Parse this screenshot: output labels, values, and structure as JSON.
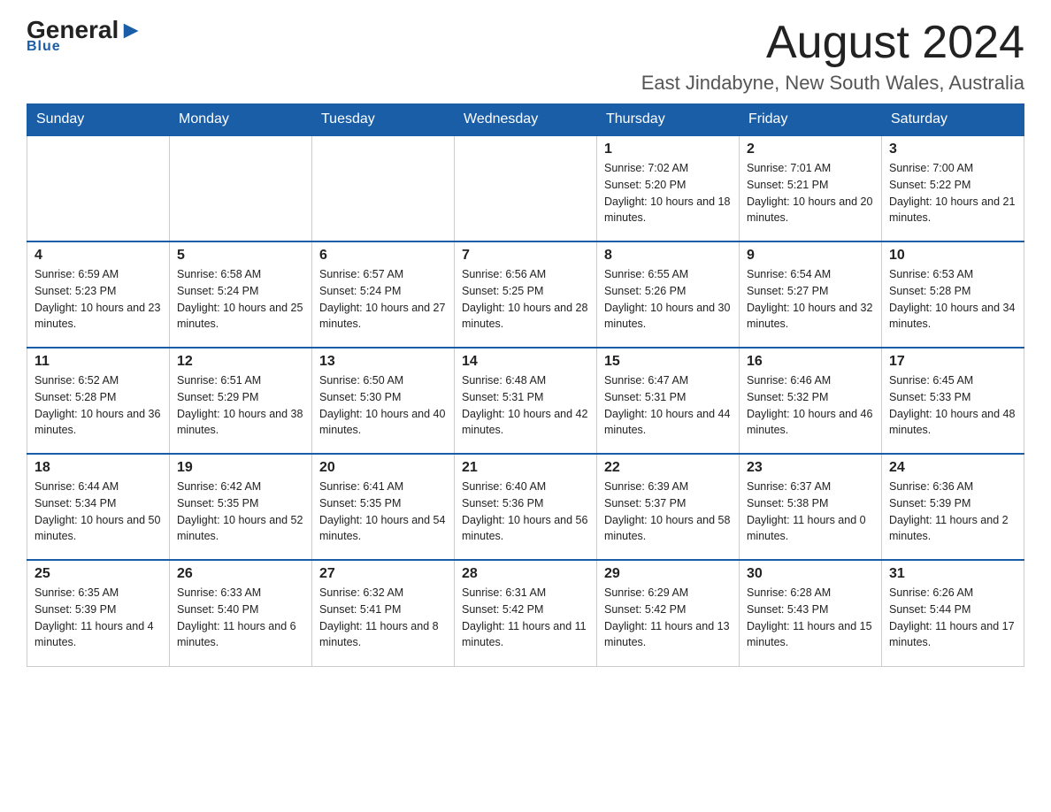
{
  "header": {
    "logo_general": "General",
    "logo_blue": "Blue",
    "month_title": "August 2024",
    "location": "East Jindabyne, New South Wales, Australia"
  },
  "days_of_week": [
    "Sunday",
    "Monday",
    "Tuesday",
    "Wednesday",
    "Thursday",
    "Friday",
    "Saturday"
  ],
  "weeks": [
    [
      {
        "num": "",
        "sunrise": "",
        "sunset": "",
        "daylight": ""
      },
      {
        "num": "",
        "sunrise": "",
        "sunset": "",
        "daylight": ""
      },
      {
        "num": "",
        "sunrise": "",
        "sunset": "",
        "daylight": ""
      },
      {
        "num": "",
        "sunrise": "",
        "sunset": "",
        "daylight": ""
      },
      {
        "num": "1",
        "sunrise": "Sunrise: 7:02 AM",
        "sunset": "Sunset: 5:20 PM",
        "daylight": "Daylight: 10 hours and 18 minutes."
      },
      {
        "num": "2",
        "sunrise": "Sunrise: 7:01 AM",
        "sunset": "Sunset: 5:21 PM",
        "daylight": "Daylight: 10 hours and 20 minutes."
      },
      {
        "num": "3",
        "sunrise": "Sunrise: 7:00 AM",
        "sunset": "Sunset: 5:22 PM",
        "daylight": "Daylight: 10 hours and 21 minutes."
      }
    ],
    [
      {
        "num": "4",
        "sunrise": "Sunrise: 6:59 AM",
        "sunset": "Sunset: 5:23 PM",
        "daylight": "Daylight: 10 hours and 23 minutes."
      },
      {
        "num": "5",
        "sunrise": "Sunrise: 6:58 AM",
        "sunset": "Sunset: 5:24 PM",
        "daylight": "Daylight: 10 hours and 25 minutes."
      },
      {
        "num": "6",
        "sunrise": "Sunrise: 6:57 AM",
        "sunset": "Sunset: 5:24 PM",
        "daylight": "Daylight: 10 hours and 27 minutes."
      },
      {
        "num": "7",
        "sunrise": "Sunrise: 6:56 AM",
        "sunset": "Sunset: 5:25 PM",
        "daylight": "Daylight: 10 hours and 28 minutes."
      },
      {
        "num": "8",
        "sunrise": "Sunrise: 6:55 AM",
        "sunset": "Sunset: 5:26 PM",
        "daylight": "Daylight: 10 hours and 30 minutes."
      },
      {
        "num": "9",
        "sunrise": "Sunrise: 6:54 AM",
        "sunset": "Sunset: 5:27 PM",
        "daylight": "Daylight: 10 hours and 32 minutes."
      },
      {
        "num": "10",
        "sunrise": "Sunrise: 6:53 AM",
        "sunset": "Sunset: 5:28 PM",
        "daylight": "Daylight: 10 hours and 34 minutes."
      }
    ],
    [
      {
        "num": "11",
        "sunrise": "Sunrise: 6:52 AM",
        "sunset": "Sunset: 5:28 PM",
        "daylight": "Daylight: 10 hours and 36 minutes."
      },
      {
        "num": "12",
        "sunrise": "Sunrise: 6:51 AM",
        "sunset": "Sunset: 5:29 PM",
        "daylight": "Daylight: 10 hours and 38 minutes."
      },
      {
        "num": "13",
        "sunrise": "Sunrise: 6:50 AM",
        "sunset": "Sunset: 5:30 PM",
        "daylight": "Daylight: 10 hours and 40 minutes."
      },
      {
        "num": "14",
        "sunrise": "Sunrise: 6:48 AM",
        "sunset": "Sunset: 5:31 PM",
        "daylight": "Daylight: 10 hours and 42 minutes."
      },
      {
        "num": "15",
        "sunrise": "Sunrise: 6:47 AM",
        "sunset": "Sunset: 5:31 PM",
        "daylight": "Daylight: 10 hours and 44 minutes."
      },
      {
        "num": "16",
        "sunrise": "Sunrise: 6:46 AM",
        "sunset": "Sunset: 5:32 PM",
        "daylight": "Daylight: 10 hours and 46 minutes."
      },
      {
        "num": "17",
        "sunrise": "Sunrise: 6:45 AM",
        "sunset": "Sunset: 5:33 PM",
        "daylight": "Daylight: 10 hours and 48 minutes."
      }
    ],
    [
      {
        "num": "18",
        "sunrise": "Sunrise: 6:44 AM",
        "sunset": "Sunset: 5:34 PM",
        "daylight": "Daylight: 10 hours and 50 minutes."
      },
      {
        "num": "19",
        "sunrise": "Sunrise: 6:42 AM",
        "sunset": "Sunset: 5:35 PM",
        "daylight": "Daylight: 10 hours and 52 minutes."
      },
      {
        "num": "20",
        "sunrise": "Sunrise: 6:41 AM",
        "sunset": "Sunset: 5:35 PM",
        "daylight": "Daylight: 10 hours and 54 minutes."
      },
      {
        "num": "21",
        "sunrise": "Sunrise: 6:40 AM",
        "sunset": "Sunset: 5:36 PM",
        "daylight": "Daylight: 10 hours and 56 minutes."
      },
      {
        "num": "22",
        "sunrise": "Sunrise: 6:39 AM",
        "sunset": "Sunset: 5:37 PM",
        "daylight": "Daylight: 10 hours and 58 minutes."
      },
      {
        "num": "23",
        "sunrise": "Sunrise: 6:37 AM",
        "sunset": "Sunset: 5:38 PM",
        "daylight": "Daylight: 11 hours and 0 minutes."
      },
      {
        "num": "24",
        "sunrise": "Sunrise: 6:36 AM",
        "sunset": "Sunset: 5:39 PM",
        "daylight": "Daylight: 11 hours and 2 minutes."
      }
    ],
    [
      {
        "num": "25",
        "sunrise": "Sunrise: 6:35 AM",
        "sunset": "Sunset: 5:39 PM",
        "daylight": "Daylight: 11 hours and 4 minutes."
      },
      {
        "num": "26",
        "sunrise": "Sunrise: 6:33 AM",
        "sunset": "Sunset: 5:40 PM",
        "daylight": "Daylight: 11 hours and 6 minutes."
      },
      {
        "num": "27",
        "sunrise": "Sunrise: 6:32 AM",
        "sunset": "Sunset: 5:41 PM",
        "daylight": "Daylight: 11 hours and 8 minutes."
      },
      {
        "num": "28",
        "sunrise": "Sunrise: 6:31 AM",
        "sunset": "Sunset: 5:42 PM",
        "daylight": "Daylight: 11 hours and 11 minutes."
      },
      {
        "num": "29",
        "sunrise": "Sunrise: 6:29 AM",
        "sunset": "Sunset: 5:42 PM",
        "daylight": "Daylight: 11 hours and 13 minutes."
      },
      {
        "num": "30",
        "sunrise": "Sunrise: 6:28 AM",
        "sunset": "Sunset: 5:43 PM",
        "daylight": "Daylight: 11 hours and 15 minutes."
      },
      {
        "num": "31",
        "sunrise": "Sunrise: 6:26 AM",
        "sunset": "Sunset: 5:44 PM",
        "daylight": "Daylight: 11 hours and 17 minutes."
      }
    ]
  ]
}
